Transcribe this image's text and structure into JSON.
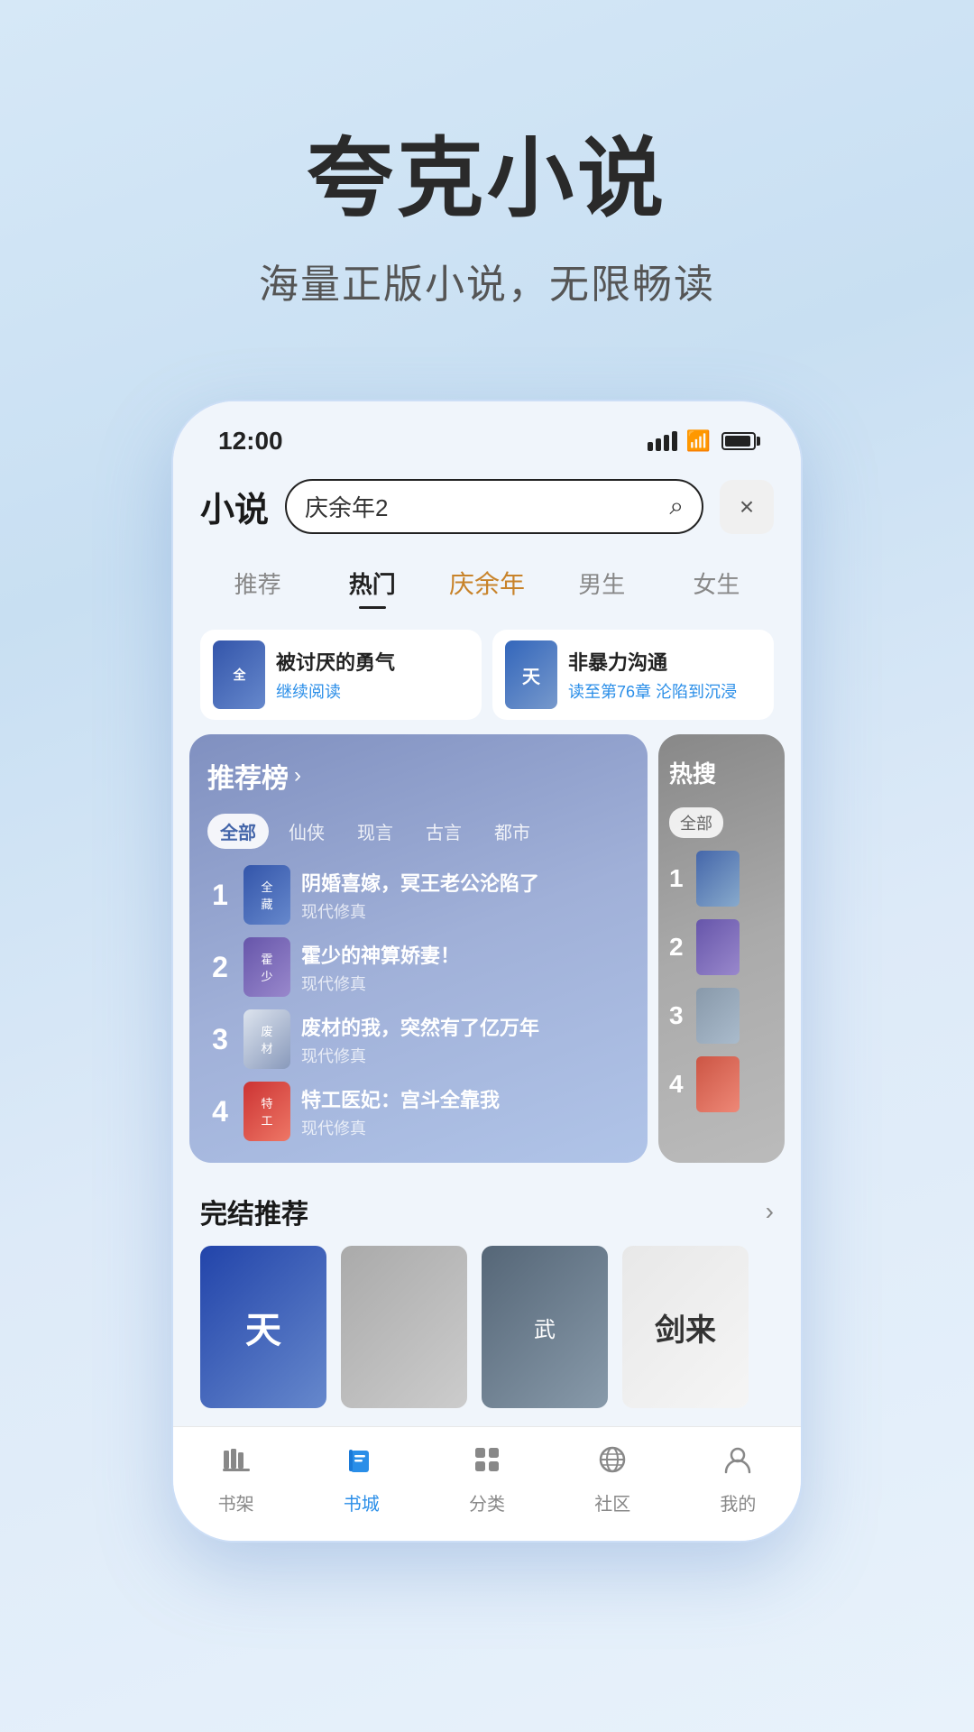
{
  "hero": {
    "title": "夸克小说",
    "subtitle": "海量正版小说，无限畅读"
  },
  "status_bar": {
    "time": "12:00"
  },
  "header": {
    "app_title": "小说",
    "search_placeholder": "庆余年2",
    "search_value": "庆余年2",
    "close_label": "×"
  },
  "nav_tabs": [
    {
      "label": "推荐",
      "active": false,
      "special": false
    },
    {
      "label": "热门",
      "active": true,
      "special": false
    },
    {
      "label": "庆余年",
      "active": false,
      "special": true
    },
    {
      "label": "男生",
      "active": false,
      "special": false
    },
    {
      "label": "女生",
      "active": false,
      "special": false
    }
  ],
  "recent_reads": [
    {
      "title": "被讨厌的勇气",
      "action": "继续阅读"
    },
    {
      "title": "非暴力沟通",
      "action": "读至第76章 沦陷到沉浸"
    }
  ],
  "ranking_panel": {
    "title": "推荐榜",
    "arrow": "›",
    "filters": [
      "全部",
      "仙侠",
      "现言",
      "古言",
      "都市"
    ],
    "active_filter": "全部",
    "items": [
      {
        "rank": "1",
        "title": "阴婚喜嫁，冥王老公沦陷了",
        "genre": "现代修真"
      },
      {
        "rank": "2",
        "title": "霍少的神算娇妻！",
        "genre": "现代修真"
      },
      {
        "rank": "3",
        "title": "废材的我，突然有了亿万年",
        "genre": "现代修真"
      },
      {
        "rank": "4",
        "title": "特工医妃：宫斗全靠我",
        "genre": "现代修真"
      }
    ]
  },
  "hot_panel": {
    "title": "热搜",
    "filter": "全部",
    "items": [
      {
        "rank": "1"
      },
      {
        "rank": "2"
      },
      {
        "rank": "3"
      },
      {
        "rank": "4"
      }
    ]
  },
  "completed_section": {
    "title": "完结推荐",
    "arrow": "›",
    "books": [
      {
        "title": "天",
        "style": "dark-blue"
      },
      {
        "title": "",
        "style": "gray"
      },
      {
        "title": "",
        "style": "dark-gray"
      },
      {
        "title": "剑来",
        "style": "text"
      }
    ]
  },
  "bottom_nav": [
    {
      "label": "书架",
      "icon": "shelf",
      "active": false
    },
    {
      "label": "书城",
      "icon": "book",
      "active": true
    },
    {
      "label": "分类",
      "icon": "grid",
      "active": false
    },
    {
      "label": "社区",
      "icon": "planet",
      "active": false
    },
    {
      "label": "我的",
      "icon": "person",
      "active": false
    }
  ]
}
